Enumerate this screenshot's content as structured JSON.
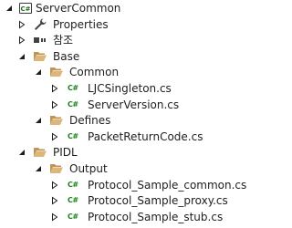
{
  "tree": {
    "project": "ServerCommon",
    "properties": "Properties",
    "references": "참조",
    "base": "Base",
    "common": "Common",
    "file_singleton": "LJCSingleton.cs",
    "file_version": "ServerVersion.cs",
    "defines": "Defines",
    "file_packet": "PacketReturnCode.cs",
    "pidl": "PIDL",
    "output": "Output",
    "file_common": "Protocol_Sample_common.cs",
    "file_proxy": "Protocol_Sample_proxy.cs",
    "file_stub": "Protocol_Sample_stub.cs",
    "cs_badge": "C#"
  },
  "colors": {
    "folder": "#dcb67a",
    "folder_dark": "#c09553",
    "cs_green": "#1b7f1b",
    "expander": "#1e1e1e"
  }
}
